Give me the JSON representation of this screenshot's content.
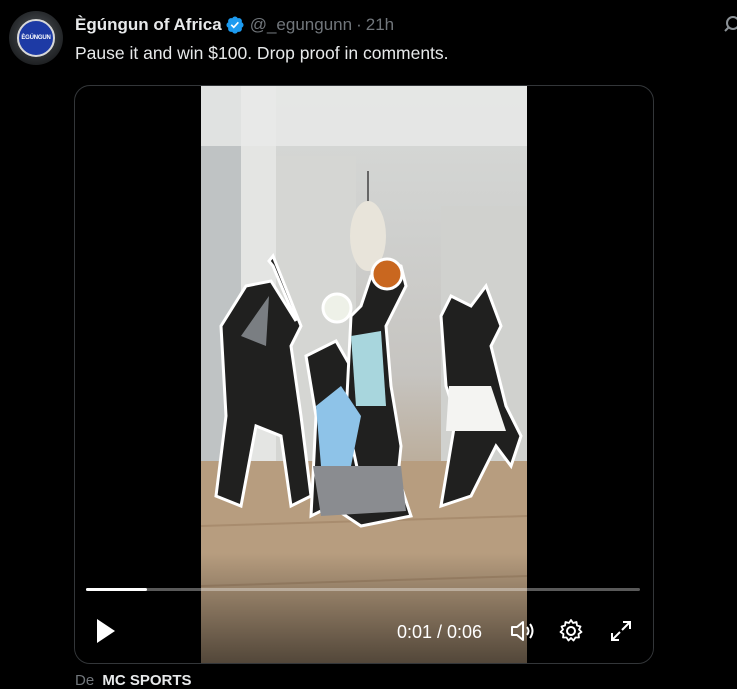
{
  "tweet": {
    "avatar_text": "ÈGÚNGUN",
    "author_name": "Ègúngun of Africa",
    "handle": "@_egungunn",
    "separator": "·",
    "timestamp": "21h",
    "text": "Pause it and win $100. Drop proof in comments.",
    "verified_color": "#1d9bf0"
  },
  "video": {
    "time_display": "0:01 / 0:06",
    "progress": 0.11
  },
  "next": {
    "prefix": "De",
    "name": "MC SPORTS"
  }
}
